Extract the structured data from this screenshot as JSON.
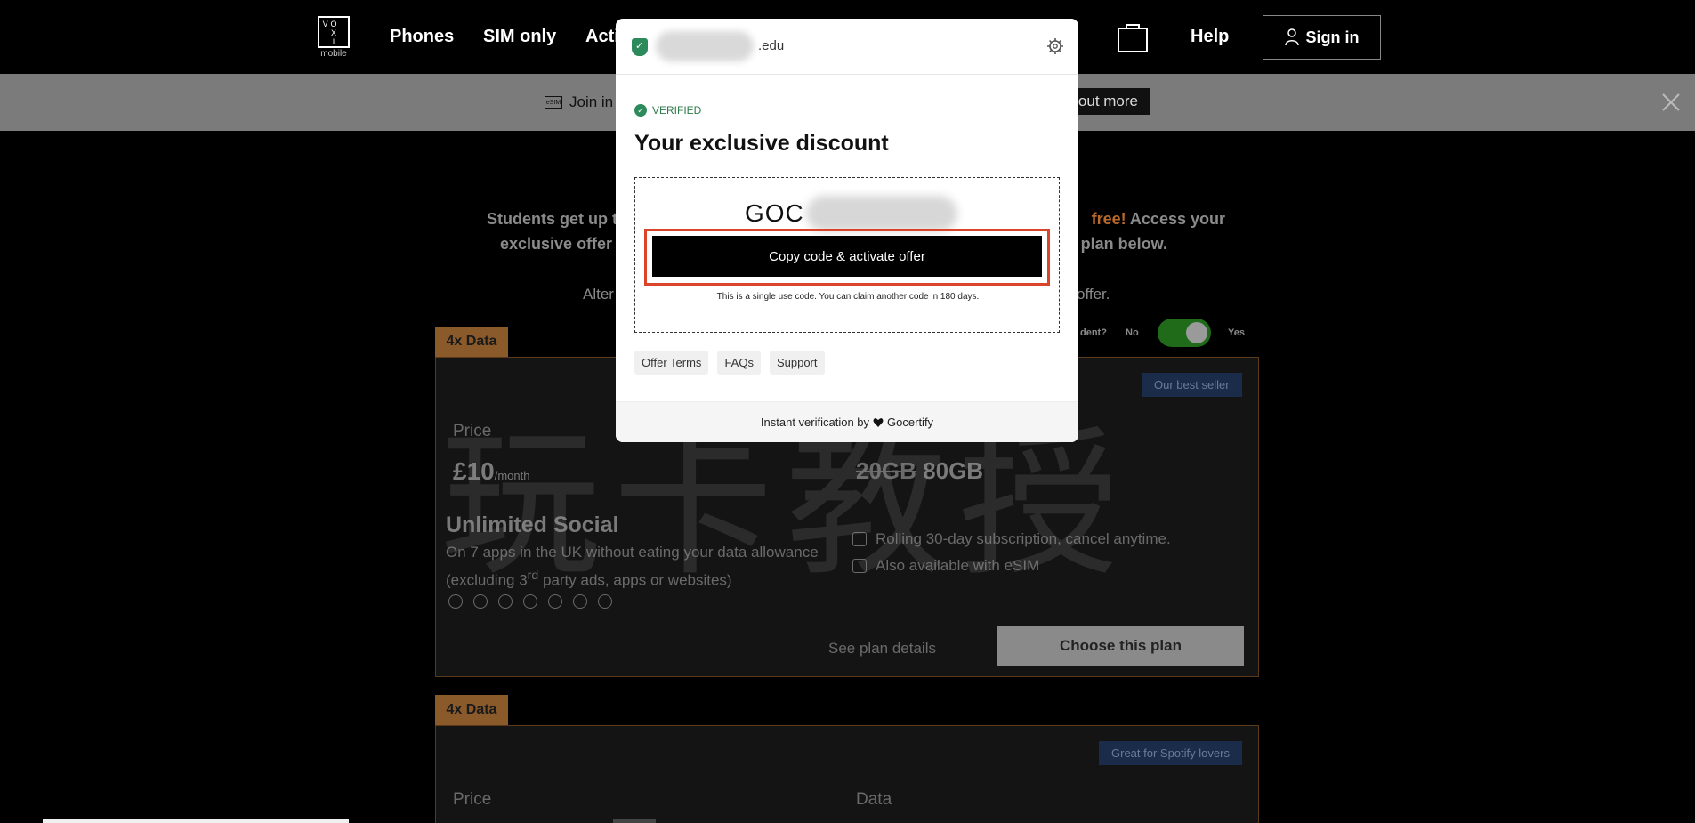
{
  "nav": {
    "logo_letters": [
      "V",
      "O",
      "",
      "",
      "X",
      "",
      "",
      "I",
      ""
    ],
    "logo_sub": "mobile",
    "links": [
      "Phones",
      "SIM only",
      "Acti"
    ],
    "help": "Help",
    "sign_in": "Sign in"
  },
  "banner": {
    "text": "Join in",
    "button": "out more"
  },
  "page": {
    "hero_line1_a": "Students get up t",
    "hero_line1_orange": "free!",
    "hero_line1_b": " Access your",
    "hero_line2_a": "exclusive offer",
    "hero_line2_b": "g a plan below.",
    "alt_a": "Alter",
    "alt_b": "offer.",
    "student_q": "dent?",
    "toggle_no": "No",
    "toggle_yes": "Yes",
    "watermark": "玩卡教授"
  },
  "cards": [
    {
      "tag": "4x Data",
      "pill": "Our best seller",
      "price_label": "Price",
      "price": "£10",
      "price_unit": "/month",
      "data_old": "20GB",
      "data_new": "80GB",
      "plan_name": "Unlimited Social",
      "plan_desc_1": "On 7 apps in the UK without eating your data allowance",
      "plan_desc_2a": "(excluding 3",
      "plan_desc_sup": "rd",
      "plan_desc_2b": " party ads, apps or websites)",
      "social_icons": [
        "snapchat-icon",
        "instagram-icon",
        "x-icon",
        "whatsapp-icon",
        "facebook-icon",
        "messenger-icon",
        "pinterest-icon"
      ],
      "feature_1": "Rolling 30-day subscription, cancel anytime.",
      "feature_2": "Also available with eSIM",
      "see_details": "See plan details",
      "choose": "Choose this plan"
    },
    {
      "tag": "4x Data",
      "pill": "Great for Spotify lovers",
      "price_label": "Price",
      "data_label": "Data"
    }
  ],
  "modal": {
    "domain_suffix": ".edu",
    "verified": "VERIFIED",
    "title": "Your exclusive discount",
    "code_prefix": "GOC",
    "copy_button": "Copy code & activate offer",
    "single_use_note": "This is a single use code. You can claim another code in 180 days.",
    "links": [
      "Offer Terms",
      "FAQs",
      "Support"
    ],
    "footer_text": "Instant verification by",
    "footer_brand": "Gocertify"
  },
  "colors": {
    "accent_green": "#2d8a5a",
    "highlight_red": "#d9442b",
    "tag_orange": "#8a5a2a"
  }
}
